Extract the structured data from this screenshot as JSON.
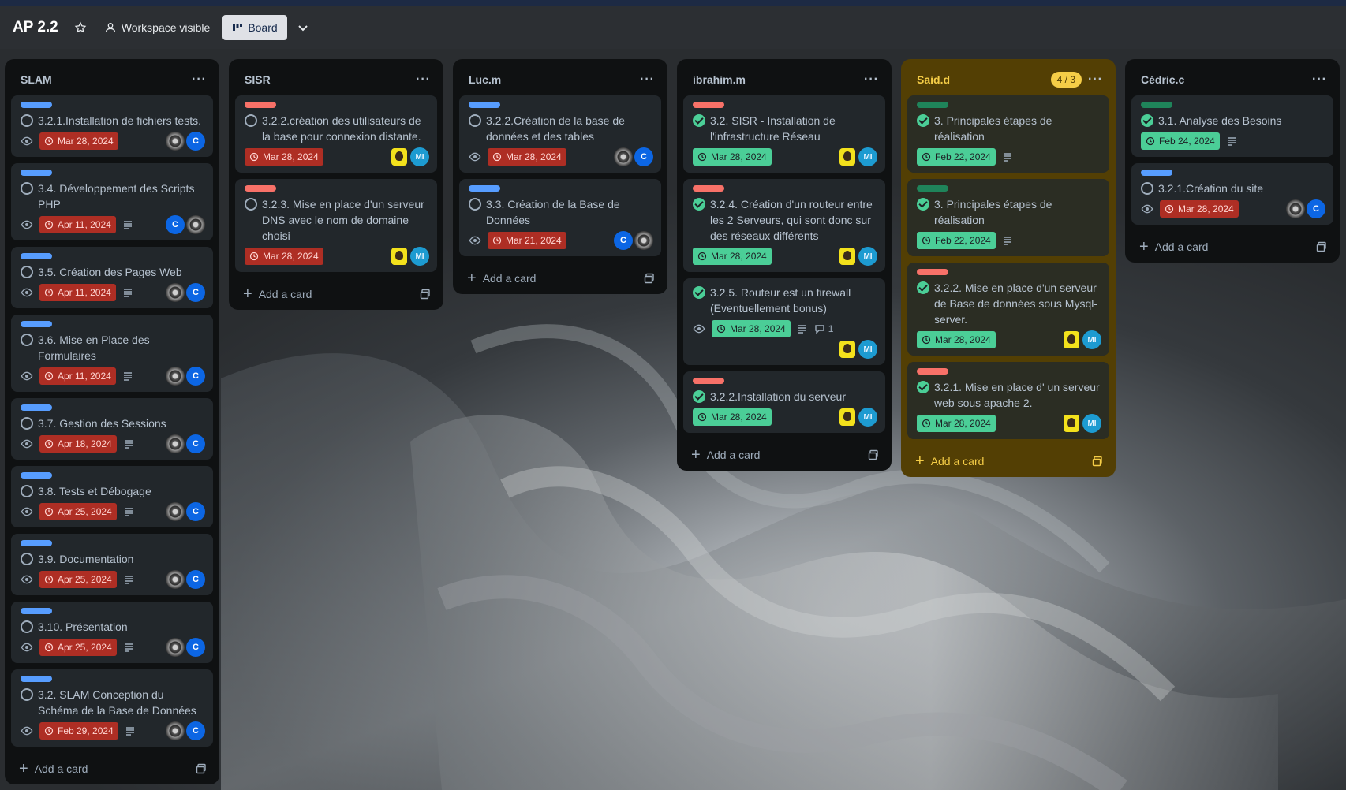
{
  "header": {
    "title": "AP 2.2",
    "visibility": "Workspace visible",
    "view": "Board"
  },
  "colors": {
    "blue": "#579dff",
    "red": "#f87168",
    "green": "#1f845a",
    "due_overdue": "#ae2e24",
    "due_done": "#4bce97",
    "yellow_list": "#533f04"
  },
  "common": {
    "add_card": "Add a card"
  },
  "lists": [
    {
      "title": "SLAM",
      "cards": [
        {
          "label": "blue",
          "title": "3.2.1.Installation de fichiers tests.",
          "date": "Mar 28, 2024"
        },
        {
          "label": "blue",
          "title": "3.4. Développement des Scripts PHP",
          "date": "Apr 11, 2024"
        },
        {
          "label": "blue",
          "title": "3.5. Création des Pages Web",
          "date": "Apr 11, 2024"
        },
        {
          "label": "blue",
          "title": "3.6. Mise en Place des Formulaires",
          "date": "Apr 11, 2024"
        },
        {
          "label": "blue",
          "title": "3.7. Gestion des Sessions",
          "date": "Apr 18, 2024"
        },
        {
          "label": "blue",
          "title": "3.8. Tests et Débogage",
          "date": "Apr 25, 2024"
        },
        {
          "label": "blue",
          "title": "3.9. Documentation",
          "date": "Apr 25, 2024"
        },
        {
          "label": "blue",
          "title": "3.10. Présentation",
          "date": "Apr 25, 2024"
        },
        {
          "label": "blue",
          "title": "3.2. SLAM Conception du Schéma de la Base de Données",
          "date": "Feb 29, 2024"
        }
      ]
    },
    {
      "title": "SISR",
      "cards": [
        {
          "label": "red",
          "title": "3.2.2.création des utilisateurs de la base pour connexion distante.",
          "date": "Mar 28, 2024"
        },
        {
          "label": "red",
          "title": "3.2.3. Mise en place d'un serveur DNS avec le nom de domaine choisi",
          "date": "Mar 28, 2024"
        }
      ]
    },
    {
      "title": "Luc.m",
      "cards": [
        {
          "label": "blue",
          "title": "3.2.2.Création de la base de données et des tables",
          "date": "Mar 28, 2024"
        },
        {
          "label": "blue",
          "title": "3.3. Création de la Base de Données",
          "date": "Mar 21, 2024"
        }
      ]
    },
    {
      "title": "ibrahim.m",
      "cards": [
        {
          "label": "red",
          "title": "3.2. SISR - Installation de l'infrastructure Réseau",
          "date": "Mar 28, 2024"
        },
        {
          "label": "red",
          "title": "3.2.4. Création d'un routeur entre les 2 Serveurs, qui sont donc sur des réseaux différents",
          "date": "Mar 28, 2024"
        },
        {
          "label": "none",
          "title": "3.2.5. Routeur est un firewall (Eventuellement bonus)",
          "date": "Mar 28, 2024",
          "comments": "1"
        },
        {
          "label": "red",
          "title": "3.2.2.Installation du serveur",
          "date": "Mar 28, 2024"
        }
      ]
    },
    {
      "title": "Said.d",
      "count": "4 / 3",
      "cards": [
        {
          "label": "green",
          "title": "3. Principales étapes de réalisation",
          "date": "Feb 22, 2024"
        },
        {
          "label": "green",
          "title": "3. Principales étapes de réalisation",
          "date": "Feb 22, 2024"
        },
        {
          "label": "red",
          "title": "3.2.2. Mise en place d'un serveur de Base de données sous Mysql-server.",
          "date": "Mar 28, 2024"
        },
        {
          "label": "red",
          "title": "3.2.1. Mise en place d' un serveur web sous apache 2.",
          "date": "Mar 28, 2024"
        }
      ]
    },
    {
      "title": "Cédric.c",
      "cards": [
        {
          "label": "green",
          "title": "3.1. Analyse des Besoins",
          "date": "Feb 24, 2024"
        },
        {
          "label": "blue",
          "title": "3.2.1.Création du site",
          "date": "Mar 28, 2024"
        }
      ]
    }
  ]
}
